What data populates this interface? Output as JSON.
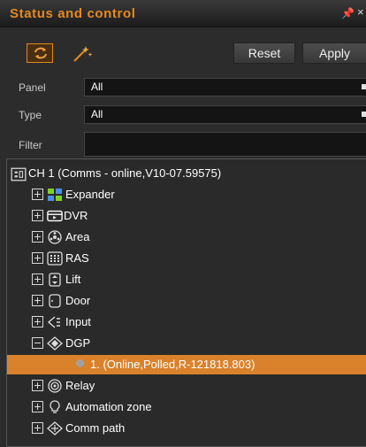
{
  "panel": {
    "title": "Status and control",
    "pin_glyph": "■",
    "close_glyph": "×"
  },
  "toolbar": {
    "refresh_icon": "refresh-icon",
    "add_icon": "add-sparkle-icon",
    "reset_label": "Reset",
    "apply_label": "Apply",
    "accent_color": "#e08a20"
  },
  "filters": {
    "panel": {
      "label": "Panel",
      "value": "All"
    },
    "type": {
      "label": "Type",
      "value": "All"
    },
    "filter": {
      "label": "Filter",
      "value": ""
    }
  },
  "tree": {
    "root": {
      "label": "CH 1 (Comms - online,V10-07.59575)",
      "icon": "controller-icon"
    },
    "items": [
      {
        "label": "Expander",
        "icon": "expander-icon",
        "expanded": false
      },
      {
        "label": "DVR",
        "icon": "dvr-icon",
        "expanded": false
      },
      {
        "label": "Area",
        "icon": "area-icon",
        "expanded": false
      },
      {
        "label": "RAS",
        "icon": "ras-keypad-icon",
        "expanded": false
      },
      {
        "label": "Lift",
        "icon": "lift-icon",
        "expanded": false
      },
      {
        "label": "Door",
        "icon": "door-icon",
        "expanded": false
      },
      {
        "label": "Input",
        "icon": "input-icon",
        "expanded": false
      },
      {
        "label": "DGP",
        "icon": "dgp-icon",
        "expanded": true
      },
      {
        "label": "1.  (Online,Polled,R-121818.803)",
        "icon": "status-dot-icon",
        "selected": true
      },
      {
        "label": "Relay",
        "icon": "relay-icon",
        "expanded": false
      },
      {
        "label": "Automation zone",
        "icon": "automation-bulb-icon",
        "expanded": false
      },
      {
        "label": "Comm path",
        "icon": "comm-path-icon",
        "expanded": false
      }
    ],
    "selected_color": "#d9822b"
  }
}
